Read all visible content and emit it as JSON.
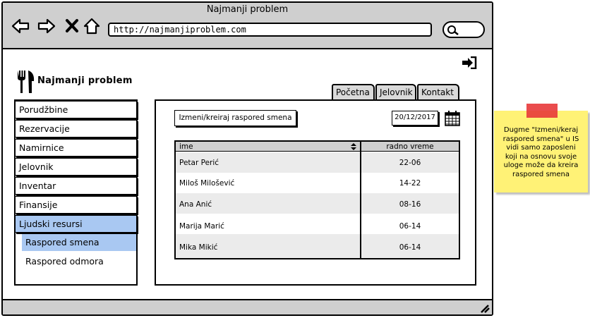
{
  "browser": {
    "title": "Najmanji problem",
    "url": "http://najmanjiproblem.com"
  },
  "app": {
    "brand": "Najmanji problem"
  },
  "sidebar": {
    "items": [
      {
        "label": "Porudžbine"
      },
      {
        "label": "Rezervacije"
      },
      {
        "label": "Namirnice"
      },
      {
        "label": "Jelovnik"
      },
      {
        "label": "Inventar"
      },
      {
        "label": "Finansije"
      },
      {
        "label": "Ljudski resursi",
        "active": true
      }
    ],
    "subitems": [
      {
        "label": "Raspored smena",
        "active": true
      },
      {
        "label": "Raspored odmora"
      }
    ]
  },
  "tabs": [
    {
      "label": "Početna"
    },
    {
      "label": "Jelovnik"
    },
    {
      "label": "Kontakt"
    }
  ],
  "main": {
    "edit_button": "Izmeni/kreiraj raspored smena",
    "date": "20/12/2017",
    "table": {
      "columns": [
        "ime",
        "radno vreme"
      ],
      "rows": [
        [
          "Petar Perić",
          "22-06"
        ],
        [
          "Miloš Milošević",
          "14-22"
        ],
        [
          "Ana Anić",
          "08-16"
        ],
        [
          "Marija Marić",
          "06-14"
        ],
        [
          "Mika Mikić",
          "06-14"
        ]
      ]
    }
  },
  "note": {
    "text": "Dugme \"Izmeni/keraj raspored smena\" u IS vidi samo zaposleni koji na osnovu svoje uloge može da kreira raspored smena"
  },
  "colors": {
    "active": "#a9c8f2",
    "chrome": "#cfcfcf",
    "note": "#fff276",
    "tape": "#e8393a"
  }
}
